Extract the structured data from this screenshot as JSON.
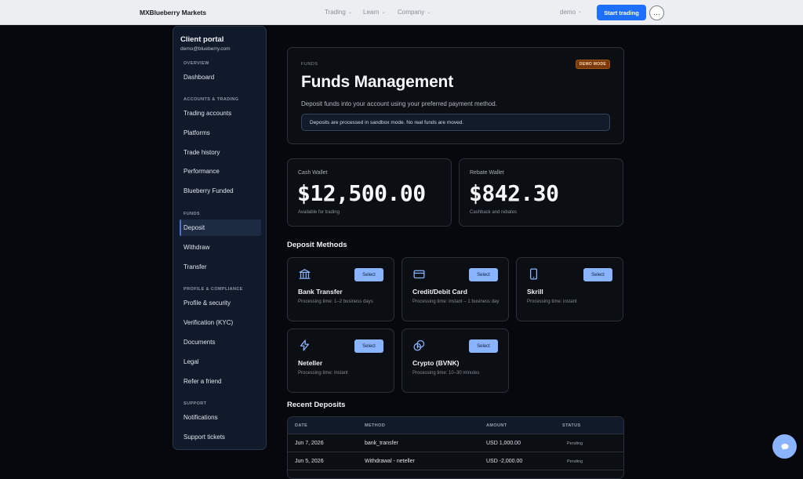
{
  "topbar": {
    "brand": "MXBlueberry Markets",
    "nav": [
      {
        "label": "Trading"
      },
      {
        "label": "Learn"
      },
      {
        "label": "Company"
      }
    ],
    "account_label": "demo",
    "start_label": "Start trading",
    "more_label": "…"
  },
  "sidebar": {
    "title": "Client portal",
    "email": "demo@blueberry.com",
    "sections": {
      "overview": "OVERVIEW",
      "accounts": "ACCOUNTS & TRADING",
      "funds": "FUNDS",
      "profile": "PROFILE & COMPLIANCE",
      "support": "SUPPORT"
    },
    "items": {
      "dashboard": "Dashboard",
      "trading_accounts": "Trading accounts",
      "platforms": "Platforms",
      "trade_history": "Trade history",
      "performance": "Performance",
      "funded": "Blueberry Funded",
      "deposit": "Deposit",
      "withdraw": "Withdraw",
      "transfer": "Transfer",
      "profile_security": "Profile & security",
      "kyc": "Verification (KYC)",
      "documents": "Documents",
      "legal": "Legal",
      "refer": "Refer a friend",
      "notifications": "Notifications",
      "tickets": "Support tickets"
    },
    "active_item": "Deposit"
  },
  "hero": {
    "eyebrow": "FUNDS",
    "badge": "DEMO MODE",
    "title": "Funds Management",
    "description": "Deposit funds into your account using your preferred payment method.",
    "notice": "Deposits are processed in sandbox mode. No real funds are moved."
  },
  "wallets": {
    "cash": {
      "label": "Cash Wallet",
      "amount": "$12,500.00",
      "sub": "Available for trading"
    },
    "rebate": {
      "label": "Rebate Wallet",
      "amount": "$842.30",
      "sub": "Cashback and rebates"
    }
  },
  "deposit_methods": {
    "title": "Deposit Methods",
    "select_label": "Select",
    "items": [
      {
        "name": "Bank Transfer",
        "time": "Processing time: 1–2 business days",
        "icon": "bank-icon"
      },
      {
        "name": "Credit/Debit Card",
        "time": "Processing time: instant – 1 business day",
        "icon": "credit-card-icon"
      },
      {
        "name": "Skrill",
        "time": "Processing time: instant",
        "icon": "mobile-phone-icon"
      },
      {
        "name": "Neteller",
        "time": "Processing time: instant",
        "icon": "lightning-icon"
      },
      {
        "name": "Crypto (BVNK)",
        "time": "Processing time: 10–30 minutes",
        "icon": "coins-icon"
      }
    ]
  },
  "recent_deposits": {
    "title": "Recent Deposits",
    "headers": [
      "DATE",
      "METHOD",
      "AMOUNT",
      "STATUS"
    ],
    "rows": [
      {
        "date": "Jun 7, 2026",
        "method": "bank_transfer",
        "amount": "USD 1,000.00",
        "status": "Pending"
      },
      {
        "date": "Jun 5, 2026",
        "method": "Withdrawal - neteller",
        "amount": "USD -2,000.00",
        "status": "Pending"
      }
    ]
  },
  "colors": {
    "accent": "#1f6fff",
    "select_button": "#8ab4ff",
    "demo_badge": "#7a3a0c"
  }
}
